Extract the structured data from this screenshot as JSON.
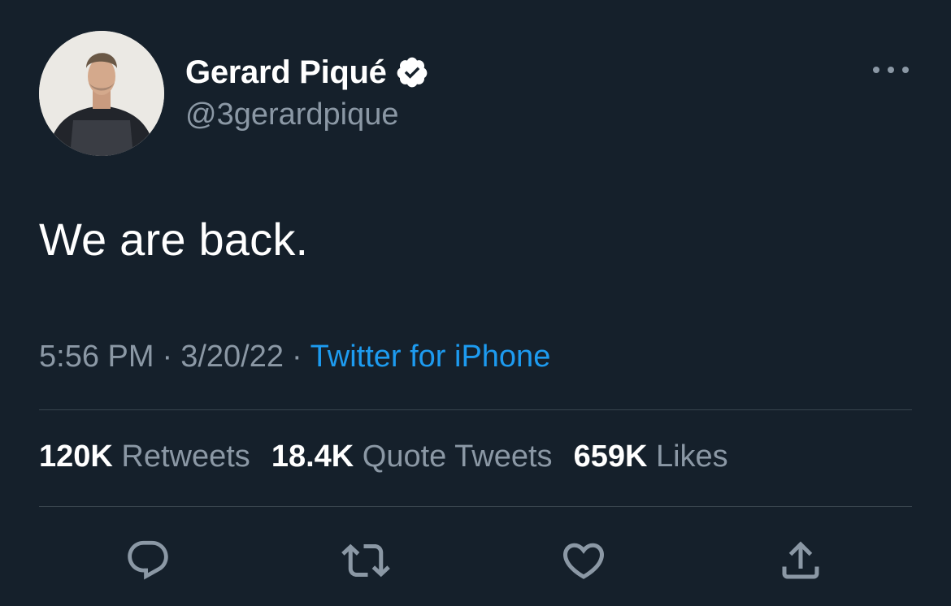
{
  "author": {
    "display_name": "Gerard Piqué",
    "handle": "@3gerardpique",
    "verified": true
  },
  "tweet": {
    "text": "We are back.",
    "time": "5:56 PM",
    "date": "3/20/22",
    "separator": "·",
    "source": "Twitter for iPhone"
  },
  "stats": {
    "retweets_count": "120K",
    "retweets_label": "Retweets",
    "quotes_count": "18.4K",
    "quotes_label": "Quote Tweets",
    "likes_count": "659K",
    "likes_label": "Likes"
  },
  "icons": {
    "more": "more-horizontal-icon",
    "reply": "reply-icon",
    "retweet": "retweet-icon",
    "like": "heart-icon",
    "share": "share-icon",
    "verified": "verified-badge-icon"
  },
  "colors": {
    "background": "#15202b",
    "primary_text": "#ffffff",
    "secondary_text": "#8b98a5",
    "link": "#1d9bf0",
    "divider": "#38444d"
  }
}
